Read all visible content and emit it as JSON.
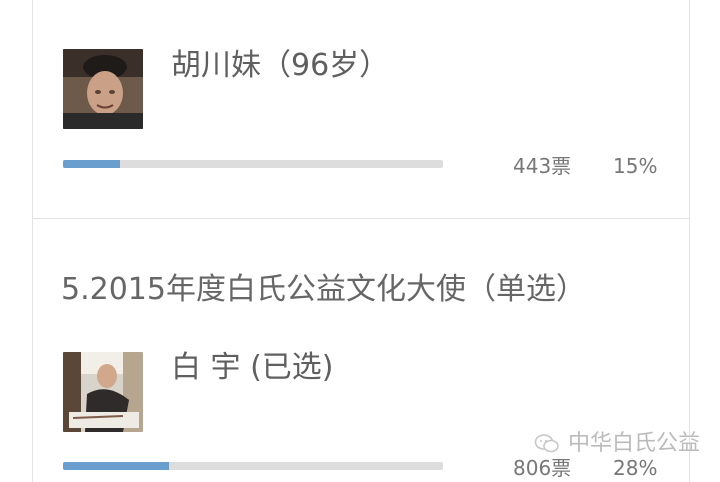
{
  "option1": {
    "name": "胡川妹（96岁）",
    "votes": "443票",
    "percent": "15%",
    "progress": 0.15
  },
  "question": {
    "title": "5.2015年度白氏公益文化大使（单选）"
  },
  "option2": {
    "name": "白 宇 (已选)",
    "votes": "806票",
    "percent": "28%",
    "progress": 0.28
  },
  "watermark": {
    "text": "中华白氏公益",
    "icon": "wechat-icon"
  },
  "colors": {
    "progress_fill": "#6a9ecf",
    "progress_track": "#dddddd"
  }
}
